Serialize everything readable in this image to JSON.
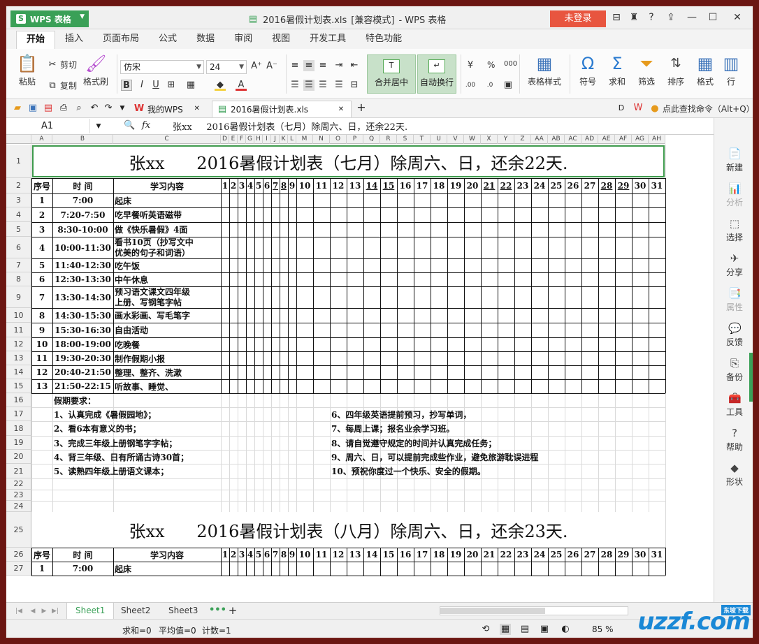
{
  "app": {
    "name": "WPS 表格",
    "title_file": "2016暑假计划表.xls",
    "title_mode": "[兼容模式]",
    "title_app": "- WPS 表格",
    "login": "未登录"
  },
  "menu_tabs": [
    "开始",
    "插入",
    "页面布局",
    "公式",
    "数据",
    "审阅",
    "视图",
    "开发工具",
    "特色功能"
  ],
  "ribbon": {
    "paste": "粘贴",
    "cut": "剪切",
    "copy": "复制",
    "format_painter": "格式刷",
    "font": "仿宋",
    "size": "24",
    "merge_center": "合并居中",
    "wrap": "自动换行",
    "table_style": "表格样式",
    "symbol": "符号",
    "sum": "求和",
    "filter": "筛选",
    "sort": "排序",
    "format": "格式",
    "row": "行",
    "percent": "%",
    "comma": "000"
  },
  "doc_tabs": {
    "mywps": "我的WPS",
    "file": "2016暑假计划表.xls",
    "find": "点此查找命令（Alt+Q）"
  },
  "formula_bar": {
    "cell_ref": "A1",
    "fx": "fx",
    "value": "张xx     2016暑假计划表（七月）除周六、日，还余22天."
  },
  "columns": [
    "A",
    "B",
    "C",
    "D",
    "E",
    "F",
    "G",
    "H",
    "I",
    "J",
    "K",
    "L",
    "M",
    "N",
    "O",
    "P",
    "Q",
    "R",
    "S",
    "T",
    "U",
    "V",
    "W",
    "X",
    "Y",
    "Z",
    "AA",
    "AB",
    "AC",
    "AD",
    "AE",
    "AF",
    "AG",
    "AH"
  ],
  "rows": [
    "1",
    "2",
    "3",
    "4",
    "5",
    "6",
    "7",
    "8",
    "9",
    "10",
    "11",
    "12",
    "13",
    "14",
    "15",
    "16",
    "17",
    "18",
    "19",
    "20",
    "21",
    "22",
    "23",
    "24",
    "25",
    "26",
    "27"
  ],
  "sheet": {
    "title_july": "张xx      2016暑假计划表（七月）除周六、日，还余22天.",
    "title_aug": "张xx      2016暑假计划表（八月）除周六、日，还余23天.",
    "hdr_no": "序号",
    "hdr_time": "时  间",
    "hdr_content": "学习内容",
    "days": [
      "1",
      "2",
      "3",
      "4",
      "5",
      "6",
      "7",
      "8",
      "9",
      "10",
      "11",
      "12",
      "13",
      "14",
      "15",
      "16",
      "17",
      "18",
      "19",
      "20",
      "21",
      "22",
      "23",
      "24",
      "25",
      "26",
      "27",
      "28",
      "29",
      "30",
      "31"
    ],
    "schedule": [
      {
        "no": "1",
        "time": "7:00",
        "content": "起床"
      },
      {
        "no": "2",
        "time": "7:20-7:50",
        "content": "吃早餐听英语磁带"
      },
      {
        "no": "3",
        "time": "8:30-10:00",
        "content": "做《快乐暑假》4面"
      },
      {
        "no": "4",
        "time": "10:00-11:30",
        "content": "看书10页（抄写文中",
        "content2": "优美的句子和词语）"
      },
      {
        "no": "5",
        "time": "11:40-12:30",
        "content": "吃午饭"
      },
      {
        "no": "6",
        "time": "12:30-13:30",
        "content": "中午休息"
      },
      {
        "no": "7",
        "time": "13:30-14:30",
        "content": "预习语文课文四年级",
        "content2": "上册、写钢笔字帖"
      },
      {
        "no": "8",
        "time": "14:30-15:30",
        "content": "画水彩画、写毛笔字"
      },
      {
        "no": "9",
        "time": "15:30-16:30",
        "content": "自由活动"
      },
      {
        "no": "10",
        "time": "18:00-19:00",
        "content": "吃晚餐"
      },
      {
        "no": "11",
        "time": "19:30-20:30",
        "content": "制作假期小报"
      },
      {
        "no": "12",
        "time": "20:40-21:50",
        "content": "整理、整齐、洗漱"
      },
      {
        "no": "13",
        "time": "21:50-22:15",
        "content": "听故事、睡觉、"
      }
    ],
    "req_title": "假期要求：",
    "req_left": [
      "1、认真完成《暑假园地》；",
      "2、看6本有意义的书；",
      "3、完成三年级上册钢笔字字帖；",
      "4、背三年级、日有所诵古诗30首；",
      "5、读熟四年级上册语文课本；"
    ],
    "req_right": [
      "6、四年级英语提前预习，抄写单词，",
      "7、每周上课；报名业余学习班。",
      "8、请自觉遵守规定的时间并认真完成任务；",
      "9、周六、日，可以提前完成些作业，避免旅游耽误进程",
      "10、预祝你度过一个快乐、安全的假期。"
    ],
    "aug_first": {
      "no": "1",
      "time": "7:00",
      "content": "起床"
    }
  },
  "sidebar": [
    "新建",
    "分析",
    "选择",
    "分享",
    "属性",
    "反馈",
    "备份",
    "工具",
    "帮助",
    "形状"
  ],
  "sheet_tabs": [
    "Sheet1",
    "Sheet2",
    "Sheet3"
  ],
  "status": {
    "sum": "求和=0",
    "avg": "平均值=0",
    "count": "计数=1",
    "zoom": "85 %"
  },
  "watermark": {
    "text": "uzzf.com",
    "sub": "东坡下载"
  }
}
